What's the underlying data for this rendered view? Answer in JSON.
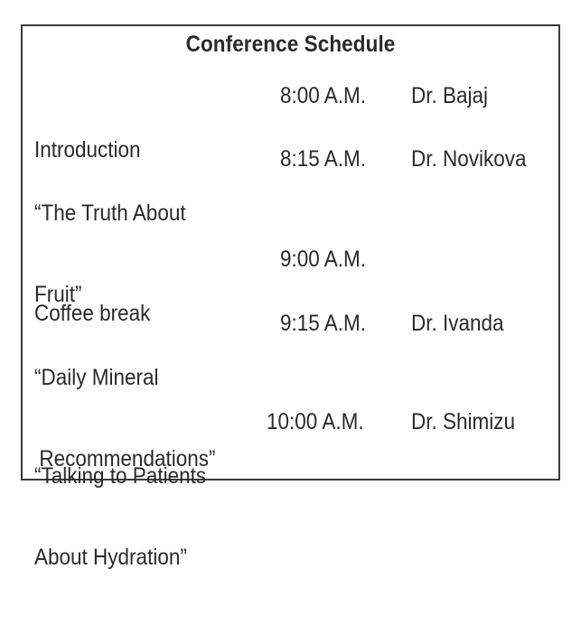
{
  "title": "Conference Schedule",
  "rows": [
    {
      "event_line1": "Introduction",
      "event_line2": "",
      "time": "8:00 A.M.",
      "speaker": "Dr. Bajaj"
    },
    {
      "event_line1": "“The Truth About",
      "event_line2": "Fruit”",
      "time": "8:15 A.M.",
      "speaker": "Dr. Novikova"
    },
    {
      "event_line1": "Coffee break",
      "event_line2": "",
      "time": "9:00 A.M.",
      "speaker": ""
    },
    {
      "event_line1": "“Daily Mineral",
      "event_line2": "Recommendations”",
      "time": "9:15 A.M.",
      "speaker": "Dr. Ivanda"
    },
    {
      "event_line1": "“Talking to Patients",
      "event_line2": "About Hydration”",
      "time": "10:00 A.M.",
      "speaker": "Dr. Shimizu"
    }
  ]
}
